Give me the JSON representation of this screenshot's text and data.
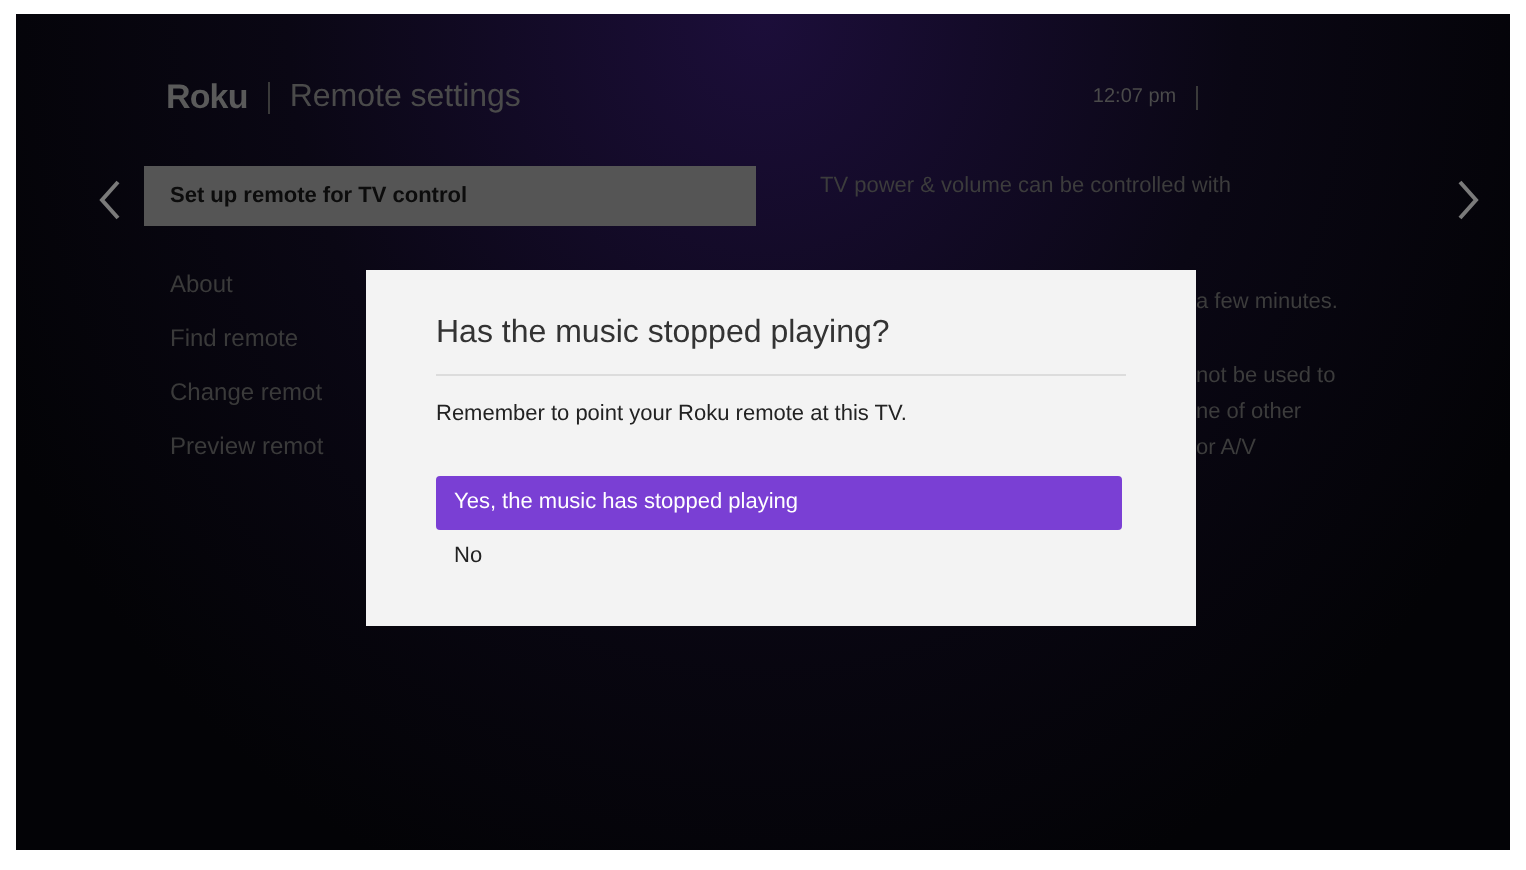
{
  "header": {
    "logo": "Roku",
    "title": "Remote settings",
    "time": "12:07 pm"
  },
  "menu": {
    "items": [
      {
        "label": "Set up remote for TV control",
        "selected": true
      },
      {
        "label": "About",
        "selected": false
      },
      {
        "label": "Find remote",
        "selected": false
      },
      {
        "label": "Change remot",
        "selected": false
      },
      {
        "label": "Preview remot",
        "selected": false
      }
    ]
  },
  "description": {
    "lines": [
      "TV power & volume can be controlled with",
      "a few minutes.",
      "not be used to",
      "ne of other",
      "or A/V"
    ]
  },
  "dialog": {
    "title": "Has the music stopped playing?",
    "message": "Remember to point your Roku remote at this TV.",
    "options": [
      {
        "label": "Yes, the music has stopped playing",
        "selected": true
      },
      {
        "label": "No",
        "selected": false
      }
    ]
  }
}
